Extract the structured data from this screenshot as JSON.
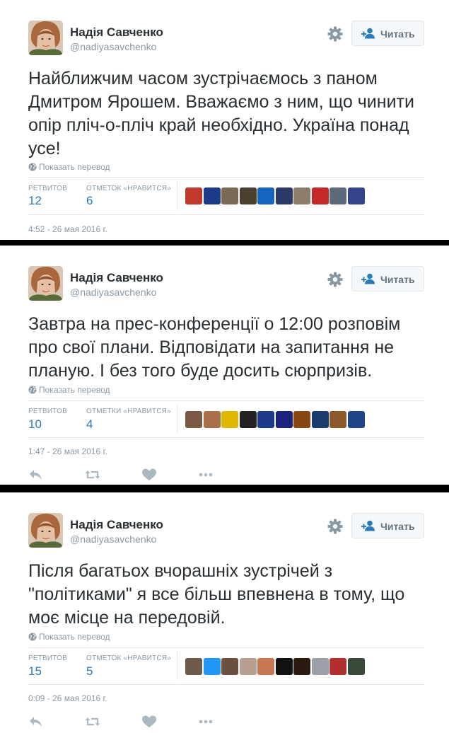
{
  "author": {
    "name": "Надія Савченко",
    "handle": "@nadiyasavchenko",
    "follow_label": "Читать"
  },
  "translate_label": "Показать перевод",
  "tweets": [
    {
      "text": "Найближчим часом зустрічаємось з паном Дмитром Ярошем. Вважаємо з ним, що чинити опір пліч-о-пліч край необхідно. Україна понад усе!",
      "retweets_label": "РЕТВИТОВ",
      "retweets": "12",
      "likes_label": "ОТМЕТОК «НРАВИТСЯ»",
      "likes": "6",
      "timestamp": "4:52 - 26 мая 2016 г.",
      "liker_colors": [
        "#c0392b",
        "#1e3a8a",
        "#7a6a55",
        "#4b4030",
        "#1565c0",
        "#2b3a67",
        "#8d7d6d",
        "#c62828",
        "#5b6b7b",
        "#334488"
      ]
    },
    {
      "text": "Завтра на прес-конференції о 12:00 розповім про свої плани. Відповідати на запитання не планую. І без того буде досить сюрпризів.",
      "retweets_label": "РЕТВИТОВ",
      "retweets": "10",
      "likes_label": "ОТМЕТКИ «НРАВИТСЯ»",
      "likes": "4",
      "timestamp": "1:47 - 26 мая 2016 г.",
      "liker_colors": [
        "#7a5a45",
        "#a86f4a",
        "#e0b800",
        "#222222",
        "#1e3a8a",
        "#1a237e",
        "#8b4513",
        "#1b3c6e",
        "#8b5a2b",
        "#224488"
      ]
    },
    {
      "text": "Після багатьох вчорашніх зустрічей з \"політиками\" я все більш впевнена в тому, що моє місце на передовій.",
      "retweets_label": "РЕТВИТОВ",
      "retweets": "15",
      "likes_label": "ОТМЕТОК «НРАВИТСЯ»",
      "likes": "5",
      "timestamp": "0:09 - 26 мая 2016 г.",
      "liker_colors": [
        "#6d5a4a",
        "#2196f3",
        "#6b5040",
        "#b8a090",
        "#c67850",
        "#111111",
        "#2a1a10",
        "#9aa0a6",
        "#b03030",
        "#3a4a3a"
      ]
    }
  ],
  "colors": {
    "link_blue": "#2b7bb9",
    "meta_gray": "#8899a6",
    "text_dark": "#292f33",
    "divider": "#000000"
  },
  "icons": {
    "settings": "gear-icon",
    "follow": "person-add-icon",
    "translate": "globe-icon",
    "reply": "reply-icon",
    "retweet": "retweet-icon",
    "like": "heart-icon",
    "more": "more-dots-icon"
  }
}
